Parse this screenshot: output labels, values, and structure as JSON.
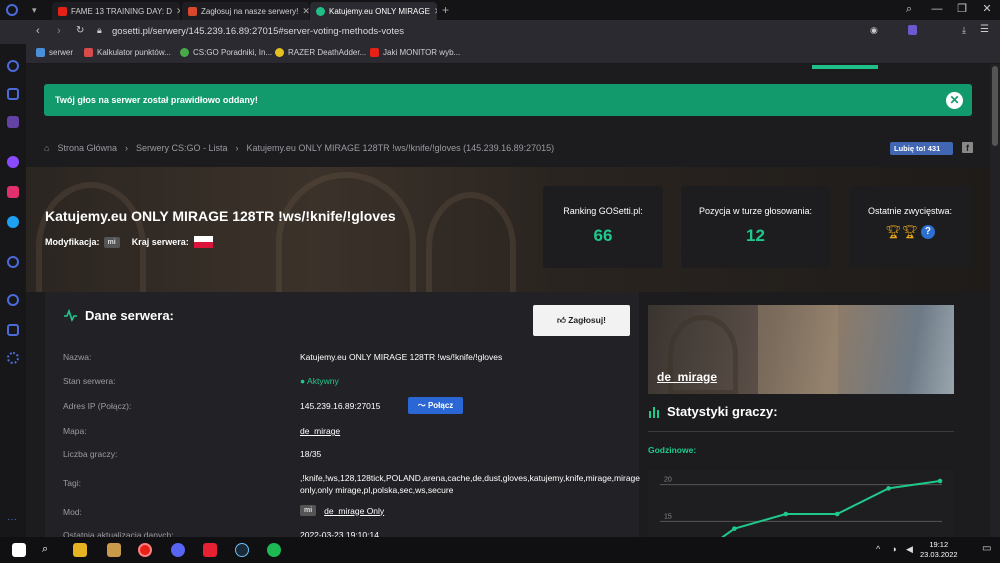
{
  "browser": {
    "tabs": [
      {
        "label": "FAME 13 TRAINING DAY: D",
        "color": "#e62117"
      },
      {
        "label": "Zagłosuj na nasze serwery!",
        "color": "#d9482c"
      },
      {
        "label": "Katujemy.eu ONLY MIRAGE",
        "color": "#1fbf87"
      }
    ],
    "url": "gosetti.pl/serwery/145.239.16.89:27015#server-voting-methods-votes",
    "bookmarks": [
      {
        "label": "serwer",
        "color": "#4a8fd9"
      },
      {
        "label": "Kalkulator punktów...",
        "color": "#d94a4a"
      },
      {
        "label": "CS:GO Poradniki, In...",
        "color": "#4aaa4a"
      },
      {
        "label": "RAZER DeathAdder...",
        "color": "#e6c020"
      },
      {
        "label": "Jaki MONITOR wyb...",
        "color": "#e62117"
      }
    ]
  },
  "alert": {
    "text": "Twój głos na serwer został prawidłowo oddany!",
    "close": "✕"
  },
  "breadcrumb": [
    "Strona Główna",
    "Serwery CS:GO - Lista",
    "Katujemy.eu ONLY MIRAGE 128TR !ws/!knife/!gloves (145.239.16.89:27015)"
  ],
  "social": {
    "like": "Lubię to! 431",
    "fb": "f"
  },
  "server": {
    "title": "Katujemy.eu ONLY MIRAGE 128TR !ws/!knife/!gloves",
    "mod_label": "Modyfikacja:",
    "mod_badge": "mi",
    "country_label": "Kraj serwera:"
  },
  "stats_cards": [
    {
      "label": "Ranking GOSetti.pl:",
      "value": "66"
    },
    {
      "label": "Pozycja w turze głosowania:",
      "value": "12"
    },
    {
      "label": "Ostatnie zwycięstwa:",
      "value": ""
    }
  ],
  "panel": {
    "title": "Dane serwera:",
    "vote_button": "Zagłosuj!",
    "rows": [
      {
        "label": "Nazwa:",
        "value": "Katujemy.eu ONLY MIRAGE 128TR !ws/!knife/!gloves"
      },
      {
        "label": "Stan serwera:",
        "value": "Aktywny"
      },
      {
        "label": "Adres IP (Połącz):",
        "value": "145.239.16.89:27015"
      },
      {
        "label": "Mapa:",
        "value": "de_mirage"
      },
      {
        "label": "Liczba graczy:",
        "value": "18/35"
      },
      {
        "label": "Tagi:",
        "value": ",!knife,!ws,128,128tick,POLAND,arena,cache,de,dust,gloves,katujemy,knife,mirage,mirage only,only mirage,pl,polska,sec,ws,secure"
      },
      {
        "label": "Mod:",
        "value": "de_mirage Only"
      },
      {
        "label": "Ostatnia aktualizacja danych:",
        "value": "2022-03-23 19:10:14"
      }
    ],
    "connect_button": "Połącz",
    "mod_badge": "mi"
  },
  "map": {
    "name": "de_mirage"
  },
  "player_stats": {
    "title": "Statystyki graczy:",
    "subtitle": "Godzinowe:"
  },
  "chart_data": {
    "type": "line",
    "title": "",
    "yticks": [
      "20",
      "15"
    ],
    "ylim": [
      10,
      22
    ],
    "x": [
      1,
      2,
      3,
      4,
      5,
      6
    ],
    "values": [
      9,
      14,
      16,
      16,
      19.5,
      20.5
    ],
    "color": "#1fc98b"
  },
  "taskbar": {
    "time": "19:12",
    "date": "23.03.2022"
  }
}
